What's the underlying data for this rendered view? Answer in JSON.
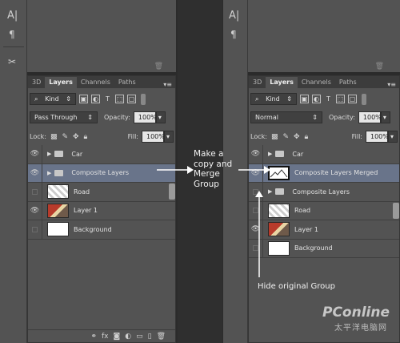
{
  "left_panel": {
    "tabs": [
      "3D",
      "Layers",
      "Channels",
      "Paths"
    ],
    "active_tab": "Layers",
    "filter_kind": "Kind",
    "blend_mode": "Pass Through",
    "opacity_label": "Opacity:",
    "opacity_value": "100%",
    "lock_label": "Lock:",
    "fill_label": "Fill:",
    "fill_value": "100%",
    "layers": [
      {
        "name": "Car",
        "type": "group",
        "visible": true,
        "selected": false
      },
      {
        "name": "Composite Layers",
        "type": "group",
        "visible": true,
        "selected": true
      },
      {
        "name": "Road",
        "type": "image",
        "visible": false,
        "selected": false
      },
      {
        "name": "Layer 1",
        "type": "image",
        "visible": true,
        "selected": false
      },
      {
        "name": "Background",
        "type": "white",
        "visible": false,
        "selected": false
      }
    ]
  },
  "right_panel": {
    "tabs": [
      "3D",
      "Layers",
      "Channels",
      "Paths"
    ],
    "active_tab": "Layers",
    "filter_kind": "Kind",
    "blend_mode": "Normal",
    "opacity_label": "Opacity:",
    "opacity_value": "100%",
    "lock_label": "Lock:",
    "fill_label": "Fill:",
    "fill_value": "100%",
    "layers": [
      {
        "name": "Car",
        "type": "group",
        "visible": true,
        "selected": false
      },
      {
        "name": "Composite Layers Merged",
        "type": "merged",
        "visible": true,
        "selected": true
      },
      {
        "name": "Composite Layers",
        "type": "group",
        "visible": false,
        "selected": false
      },
      {
        "name": "Road",
        "type": "image",
        "visible": false,
        "selected": false
      },
      {
        "name": "Layer 1",
        "type": "image",
        "visible": true,
        "selected": false
      },
      {
        "name": "Background",
        "type": "white",
        "visible": false,
        "selected": false
      }
    ]
  },
  "annotations": {
    "make_copy": "Make a copy and Merge Group",
    "hide_original": "Hide original Group"
  },
  "watermark": {
    "brand": "PConline",
    "subtitle": "太平洋电脑网"
  },
  "icons": [
    "text-tool-icon",
    "paragraph-icon",
    "tools-icon",
    "eye-icon",
    "folder-icon",
    "trash-icon"
  ],
  "colors": {
    "panel": "#535353",
    "selected": "#69748a",
    "dark": "#2b2b2b"
  }
}
